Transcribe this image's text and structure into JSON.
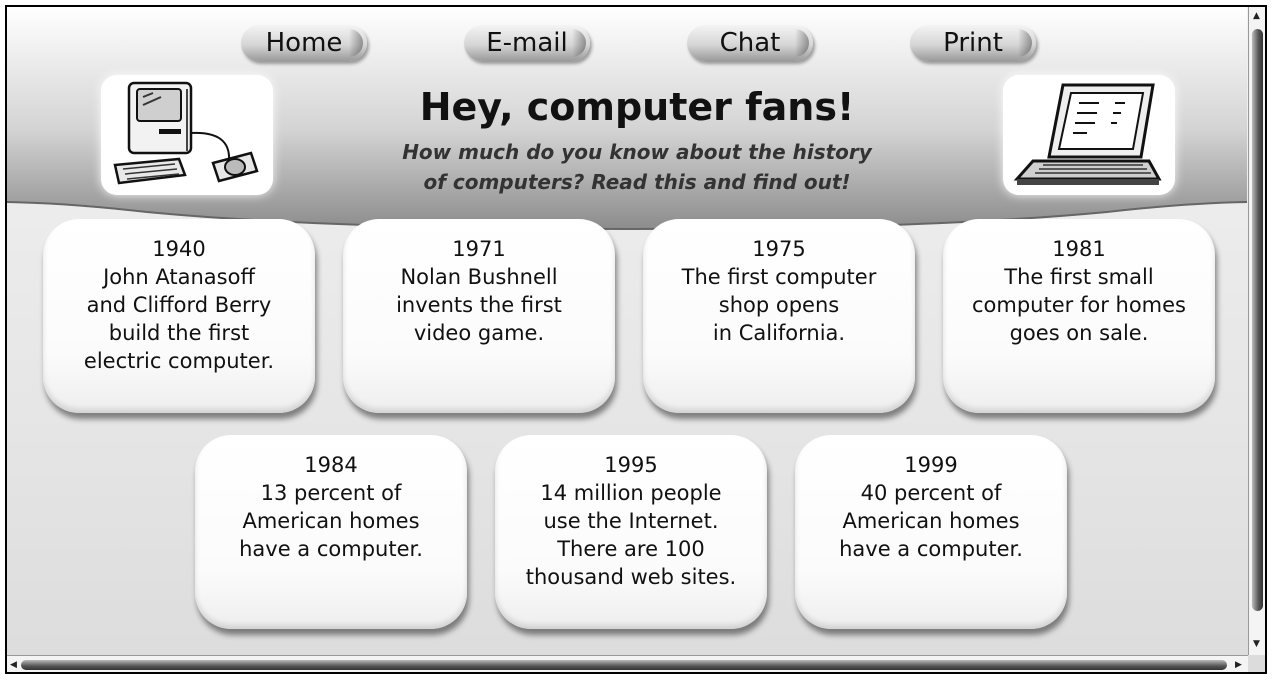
{
  "nav": {
    "home": "Home",
    "email": "E-mail",
    "chat": "Chat",
    "print": "Print"
  },
  "header": {
    "title": "Hey, computer fans!",
    "subtitle_line1": "How much do you know about the history",
    "subtitle_line2": "of computers? Read this and find out!"
  },
  "icons": {
    "left": "desktop-computer-icon",
    "right": "laptop-icon"
  },
  "timeline": [
    {
      "year": "1940",
      "lines": [
        "John Atanasoff",
        "and Clifford Berry",
        "build the first",
        "electric computer."
      ]
    },
    {
      "year": "1971",
      "lines": [
        "Nolan Bushnell",
        "invents the first",
        "video game."
      ]
    },
    {
      "year": "1975",
      "lines": [
        "The first computer",
        "shop opens",
        "in California."
      ]
    },
    {
      "year": "1981",
      "lines": [
        "The first small",
        "computer for homes",
        "goes on sale."
      ]
    },
    {
      "year": "1984",
      "lines": [
        "13 percent of",
        "American homes",
        "have a computer."
      ]
    },
    {
      "year": "1995",
      "lines": [
        "14 million people",
        "use the Internet.",
        "There are 100",
        "thousand web sites."
      ]
    },
    {
      "year": "1999",
      "lines": [
        "40 percent of",
        "American homes",
        "have a computer."
      ]
    }
  ],
  "colors": {
    "band": "#9a9a9a",
    "card": "#ffffff",
    "text": "#111111"
  }
}
